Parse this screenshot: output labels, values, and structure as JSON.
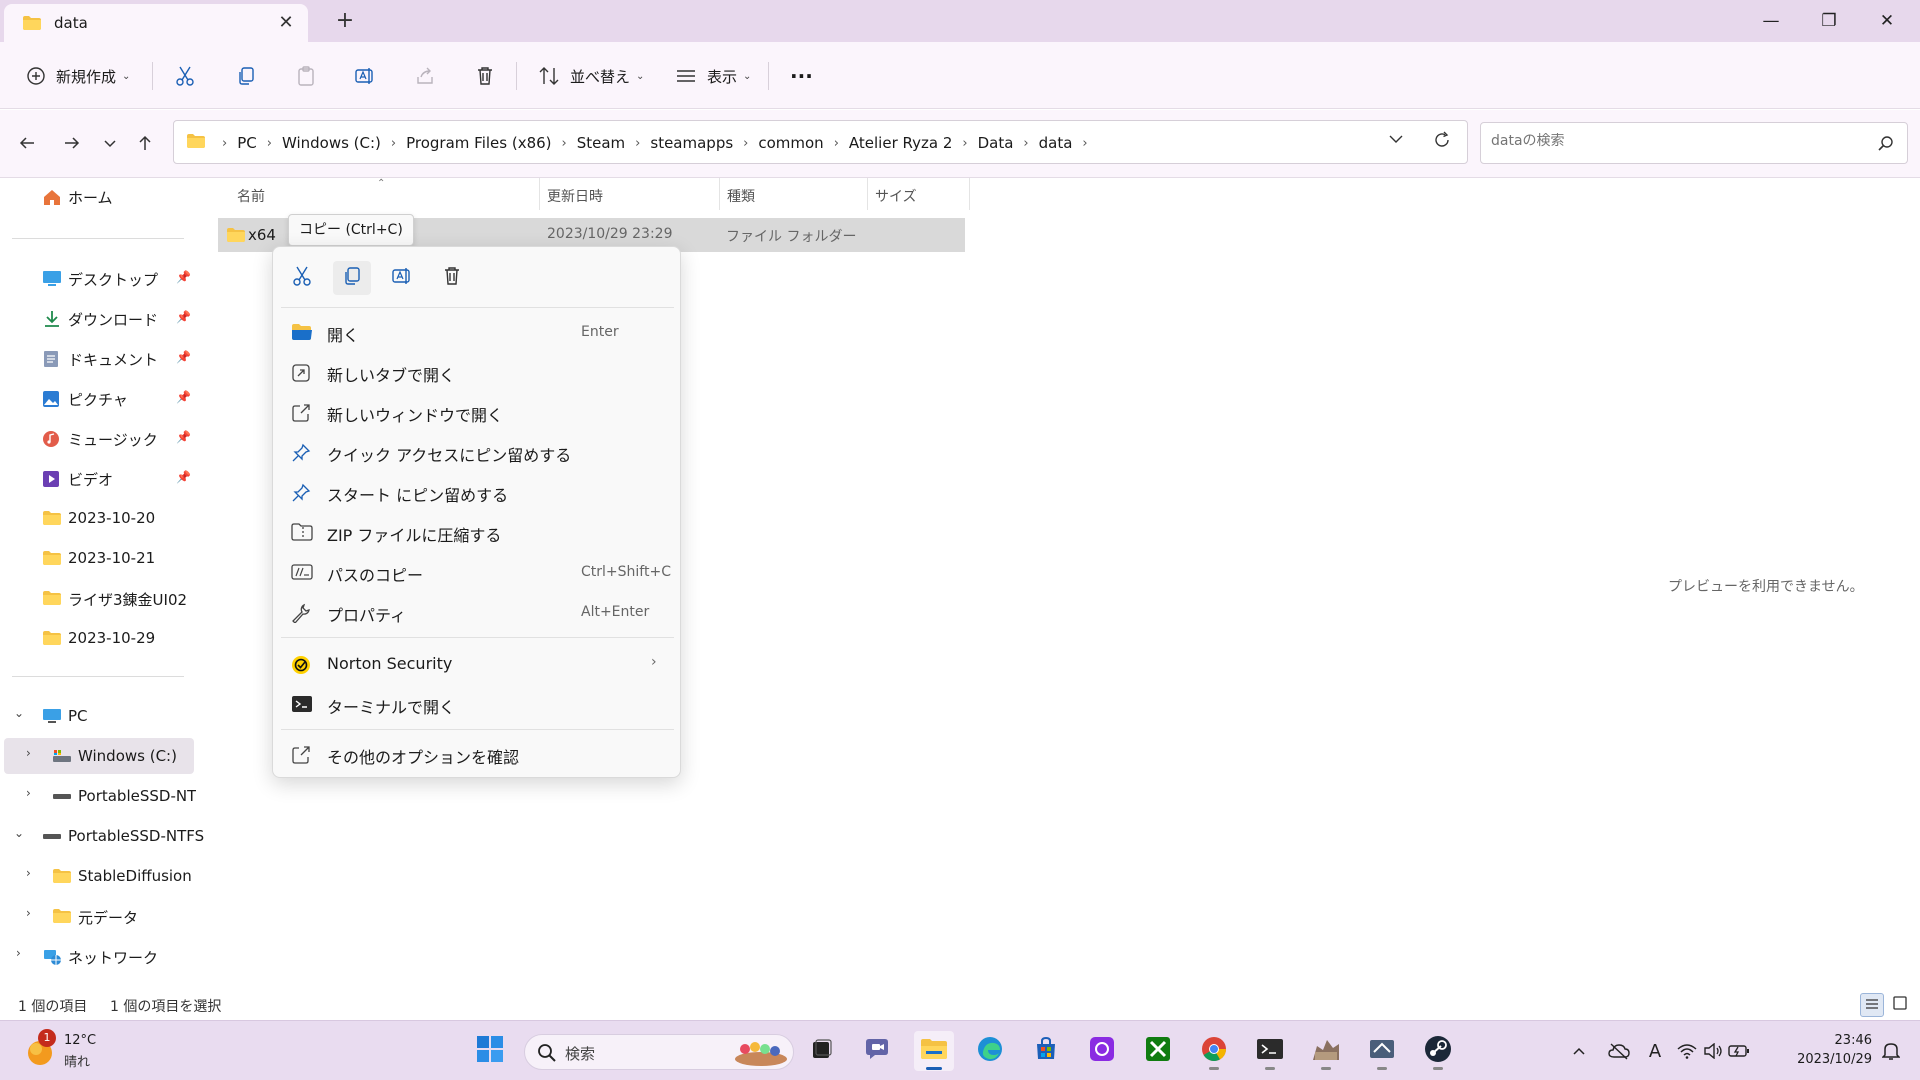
{
  "window": {
    "tab_title": "data",
    "close_tab": "✕",
    "new_tab": "+",
    "minimize": "—",
    "restore": "❐",
    "close": "✕"
  },
  "toolbar": {
    "new_label": "新規作成",
    "sort_label": "並べ替え",
    "view_label": "表示",
    "more": "···"
  },
  "address": {
    "breadcrumbs": [
      "PC",
      "Windows (C:)",
      "Program Files (x86)",
      "Steam",
      "steamapps",
      "common",
      "Atelier Ryza 2",
      "Data",
      "data"
    ],
    "search_placeholder": "dataの検索"
  },
  "nav": {
    "home": "ホーム",
    "quick": [
      {
        "label": "デスクトップ",
        "icon": "desktop-icon"
      },
      {
        "label": "ダウンロード",
        "icon": "download-icon"
      },
      {
        "label": "ドキュメント",
        "icon": "documents-icon"
      },
      {
        "label": "ピクチャ",
        "icon": "pictures-icon"
      },
      {
        "label": "ミュージック",
        "icon": "music-icon"
      },
      {
        "label": "ビデオ",
        "icon": "video-icon"
      }
    ],
    "folders": [
      "2023-10-20",
      "2023-10-21",
      "ライザ3錬金UI02",
      "2023-10-29"
    ],
    "pc": "PC",
    "windows_c": "Windows (C:)",
    "portable_sub": "PortableSSD-NTFS",
    "portable": "PortableSSD-NTFS",
    "stable": "StableDiffusion",
    "moto": "元データ",
    "network": "ネットワーク"
  },
  "columns": {
    "name": "名前",
    "date": "更新日時",
    "type": "種類",
    "size": "サイズ"
  },
  "file": {
    "name": "x64",
    "date": "2023/10/29 23:29",
    "type": "ファイル フォルダー"
  },
  "tooltip": "コピー (Ctrl+C)",
  "context_menu": {
    "open": {
      "label": "開く",
      "key": "Enter"
    },
    "new_tab": {
      "label": "新しいタブで開く"
    },
    "new_window": {
      "label": "新しいウィンドウで開く"
    },
    "pin_quick": {
      "label": "クイック アクセスにピン留めする"
    },
    "pin_start": {
      "label": "スタート にピン留めする"
    },
    "zip": {
      "label": "ZIP ファイルに圧縮する"
    },
    "copy_path": {
      "label": "パスのコピー",
      "key": "Ctrl+Shift+C"
    },
    "properties": {
      "label": "プロパティ",
      "key": "Alt+Enter"
    },
    "norton": {
      "label": "Norton Security"
    },
    "terminal": {
      "label": "ターミナルで開く"
    },
    "more_options": {
      "label": "その他のオプションを確認"
    }
  },
  "preview_message": "プレビューを利用できません。",
  "status": {
    "items": "1 個の項目",
    "selected": "1 個の項目を選択"
  },
  "taskbar": {
    "weather_temp": "12°C",
    "weather_cond": "晴れ",
    "weather_badge": "1",
    "search": "検索",
    "time": "23:46",
    "date": "2023/10/29"
  },
  "colors": {
    "titlebar": "#e7d8ec",
    "accent": "#1a5fb4",
    "folder": "#f5c244"
  }
}
